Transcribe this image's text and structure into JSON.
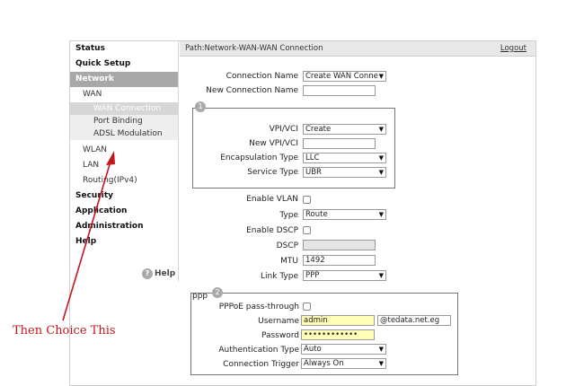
{
  "sidebar": {
    "items": [
      {
        "label": "Status"
      },
      {
        "label": "Quick Setup"
      },
      {
        "label": "Network"
      },
      {
        "label": "WAN"
      },
      {
        "label": "WAN Connection"
      },
      {
        "label": "Port Binding"
      },
      {
        "label": "ADSL Modulation"
      },
      {
        "label": "WLAN"
      },
      {
        "label": "LAN"
      },
      {
        "label": "Routing(IPv4)"
      },
      {
        "label": "Security"
      },
      {
        "label": "Application"
      },
      {
        "label": "Administration"
      },
      {
        "label": "Help"
      }
    ],
    "help_label": "Help",
    "help_icon_text": "?"
  },
  "header": {
    "path": "Path:Network-WAN-WAN Connection",
    "logout": "Logout"
  },
  "form": {
    "connection_name": {
      "label": "Connection Name",
      "value": "Create WAN Conne"
    },
    "new_connection_name": {
      "label": "New Connection Name",
      "value": ""
    },
    "section1_badge": "1",
    "vpi_vci": {
      "label": "VPI/VCI",
      "value": "Create"
    },
    "new_vpi_vci": {
      "label": "New VPI/VCI",
      "value": ""
    },
    "encapsulation": {
      "label": "Encapsulation Type",
      "value": "LLC"
    },
    "service_type": {
      "label": "Service Type",
      "value": "UBR"
    },
    "enable_vlan": {
      "label": "Enable VLAN"
    },
    "type": {
      "label": "Type",
      "value": "Route"
    },
    "enable_dscp": {
      "label": "Enable DSCP"
    },
    "dscp": {
      "label": "DSCP",
      "value": ""
    },
    "mtu": {
      "label": "MTU",
      "value": "1492"
    },
    "link_type": {
      "label": "Link Type",
      "value": "PPP"
    },
    "ppp_title": "ppp",
    "section2_badge": "2",
    "pppoe_passthrough": {
      "label": "PPPoE pass-through"
    },
    "username": {
      "label": "Username",
      "value": "admin",
      "suffix": "@tedata.net.eg"
    },
    "password": {
      "label": "Password",
      "value": "••••••••••••"
    },
    "auth_type": {
      "label": "Authentication Type",
      "value": "Auto"
    },
    "connection_trigger": {
      "label": "Connection Trigger",
      "value": "Always On"
    }
  },
  "annotation": {
    "text": "Then Choice This",
    "color": "#c4161c"
  },
  "colors": {
    "sidebar_active": "#a8a8a8",
    "input_highlight": "#ffffb8"
  }
}
